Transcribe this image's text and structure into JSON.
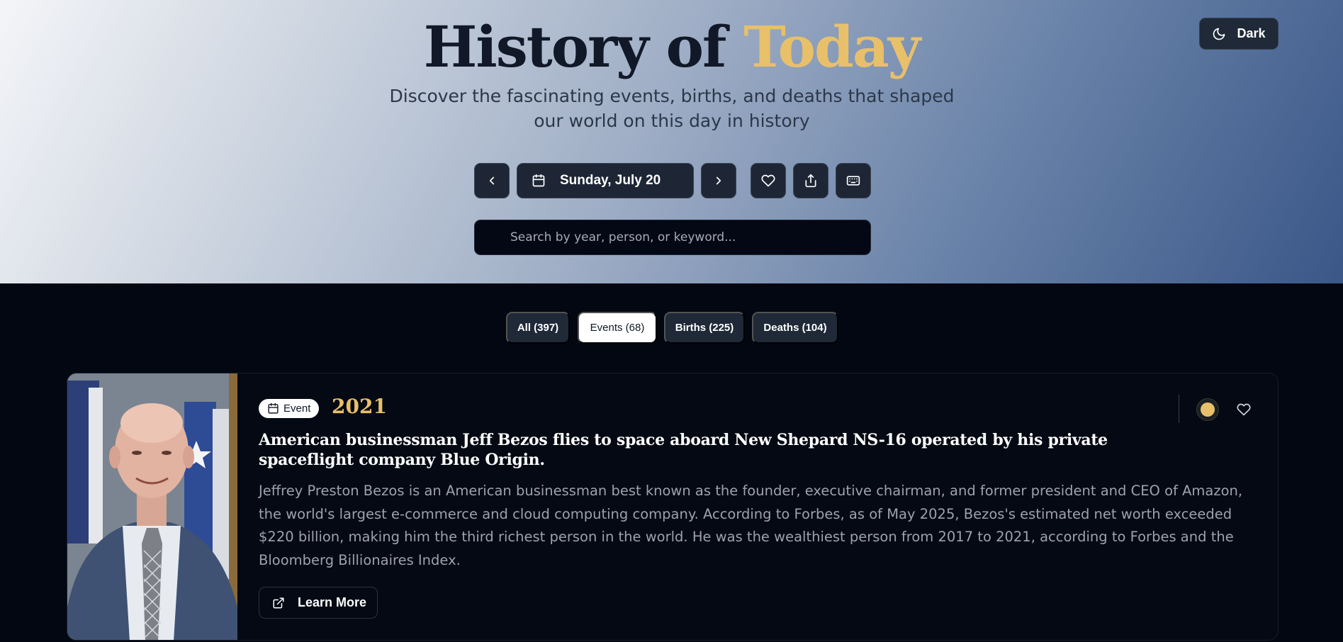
{
  "header": {
    "title_main": "History of",
    "title_accent": "Today",
    "subtitle": "Discover the fascinating events, births, and deaths that shaped our world on this day in history",
    "theme_toggle_label": "Dark",
    "accent_color": "#e8c06a"
  },
  "date_nav": {
    "prev_icon": "chevron-left-icon",
    "date_label": "Sunday, July 20",
    "next_icon": "chevron-right-icon",
    "favorites_icon": "heart-icon",
    "share_icon": "share-icon",
    "keyboard_icon": "keyboard-icon"
  },
  "search": {
    "placeholder": "Search by year, person, or keyword...",
    "value": ""
  },
  "filters": [
    {
      "label": "All (397)",
      "active": false
    },
    {
      "label": "Events (68)",
      "active": true
    },
    {
      "label": "Births (225)",
      "active": false
    },
    {
      "label": "Deaths (104)",
      "active": false
    }
  ],
  "event": {
    "badge_label": "Event",
    "year": "2021",
    "title": "American businessman Jeff Bezos flies to space aboard New Shepard NS-16 operated by his private spaceflight company Blue Origin.",
    "description": "Jeffrey Preston Bezos is an American businessman best known as the founder, executive chairman, and former president and CEO of Amazon, the world's largest e-commerce and cloud computing company. According to Forbes, as of May 2025, Bezos's estimated net worth exceeded $220 billion, making him the third richest person in the world. He was the wealthiest person from 2017 to 2021, according to Forbes and the Bloomberg Billionaires Index.",
    "learn_more_label": "Learn More"
  }
}
